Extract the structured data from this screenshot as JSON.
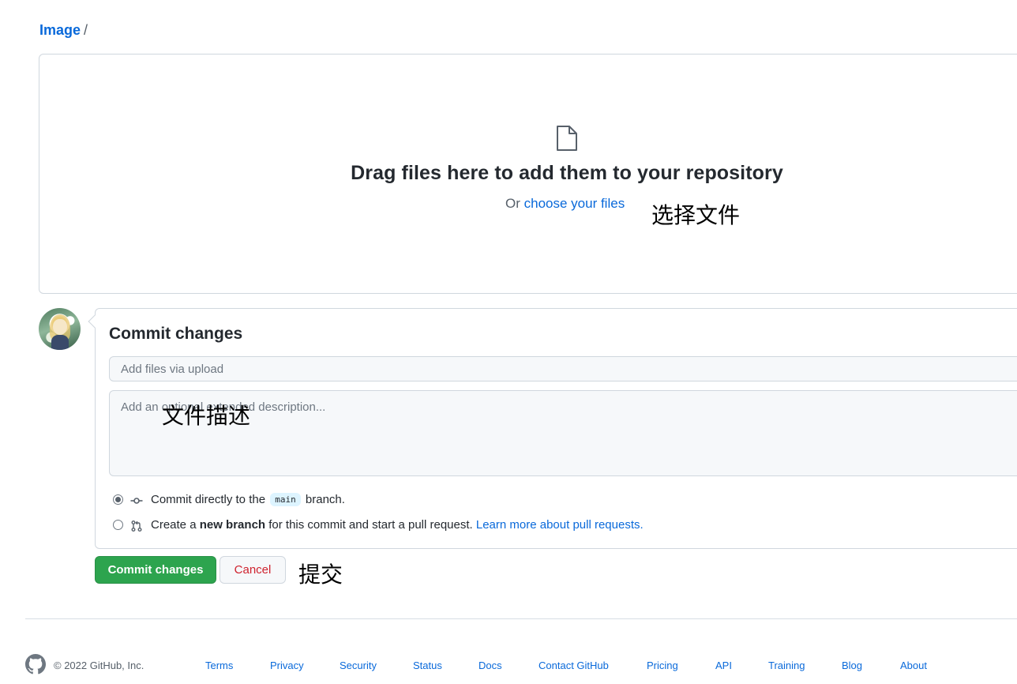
{
  "breadcrumb": {
    "repo": "Image",
    "separator": "/"
  },
  "dropzone": {
    "title": "Drag files here to add them to your repository",
    "or_text": "Or",
    "choose_link": "choose your files",
    "icon": "file-icon"
  },
  "annotations": {
    "choose_files": "选择文件",
    "description": "文件描述",
    "submit": "提交"
  },
  "commit": {
    "title": "Commit changes",
    "summary_placeholder": "Add files via upload",
    "description_placeholder": "Add an optional extended description...",
    "option_direct": {
      "prefix": "Commit directly to the",
      "branch": "main",
      "suffix": "branch.",
      "selected": true
    },
    "option_new_branch": {
      "prefix": "Create a",
      "bold": "new branch",
      "suffix": "for this commit and start a pull request.",
      "link": "Learn more about pull requests.",
      "selected": false
    }
  },
  "buttons": {
    "commit": "Commit changes",
    "cancel": "Cancel"
  },
  "footer": {
    "copyright": "© 2022 GitHub, Inc.",
    "links": [
      "Terms",
      "Privacy",
      "Security",
      "Status",
      "Docs",
      "Contact GitHub",
      "Pricing",
      "API",
      "Training",
      "Blog",
      "About"
    ]
  },
  "colors": {
    "accent": "#0969da",
    "primary_button": "#2da44e",
    "danger": "#cf222e",
    "border": "#d0d7de"
  }
}
